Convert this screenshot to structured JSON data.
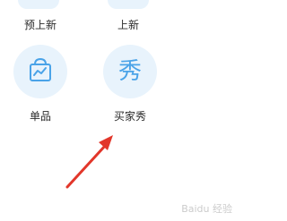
{
  "top_tiles": [
    {
      "label": "预上新"
    },
    {
      "label": "上新"
    }
  ],
  "tiles": [
    {
      "label": "单品",
      "icon": "shopping-bag-chart-icon"
    },
    {
      "label": "买家秀",
      "icon": "xiu-character-icon",
      "glyph": "秀"
    }
  ],
  "colors": {
    "icon_bg": "#e8f3fc",
    "icon_fg": "#4aa3e8",
    "arrow": "#e2362a",
    "label": "#2a2a2a"
  },
  "watermark": "Baidu 经验"
}
